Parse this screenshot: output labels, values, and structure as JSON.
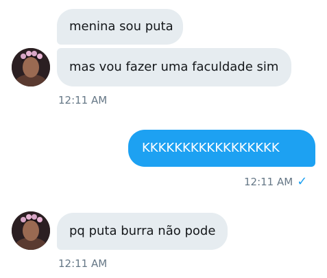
{
  "conversation": {
    "messages": [
      {
        "direction": "in",
        "text": "menina sou puta"
      },
      {
        "direction": "in",
        "text": "mas vou fazer uma faculdade sim"
      },
      {
        "direction": "out",
        "text": "KKKKKKKKKKKKKKKKK"
      },
      {
        "direction": "in",
        "text": "pq puta burra não pode"
      }
    ],
    "timestamps": [
      {
        "text": "12:11 AM"
      },
      {
        "text": "12:11 AM",
        "status_icon": "check-icon",
        "status_glyph": "✓"
      },
      {
        "text": "12:11 AM"
      }
    ]
  },
  "colors": {
    "incoming_bubble": "#e6ecf0",
    "outgoing_bubble": "#1da1f2",
    "timestamp_text": "#657786",
    "read_check": "#1da1f2"
  }
}
